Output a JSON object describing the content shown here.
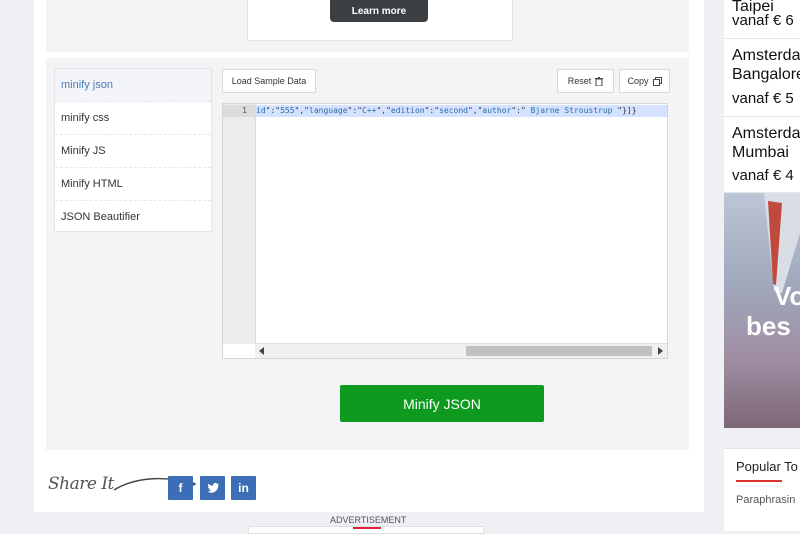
{
  "ad_top": {
    "learn_more": "Learn more"
  },
  "tools": [
    {
      "label": "minify json",
      "active": true
    },
    {
      "label": "minify css",
      "active": false
    },
    {
      "label": "Minify JS",
      "active": false
    },
    {
      "label": "Minify HTML",
      "active": false
    },
    {
      "label": "JSON Beautifier",
      "active": false
    }
  ],
  "toolbar": {
    "load_sample": "Load Sample Data",
    "reset": "Reset",
    "copy": "Copy"
  },
  "editor": {
    "line_number": "1",
    "code_segments": [
      {
        "t": "id",
        "k": "s"
      },
      {
        "t": "\":\"",
        "k": "p"
      },
      {
        "t": "555",
        "k": "s"
      },
      {
        "t": "\",\"",
        "k": "p"
      },
      {
        "t": "language",
        "k": "s"
      },
      {
        "t": "\":\"",
        "k": "p"
      },
      {
        "t": "C++",
        "k": "s"
      },
      {
        "t": "\",\"",
        "k": "p"
      },
      {
        "t": "edition",
        "k": "s"
      },
      {
        "t": "\":\"",
        "k": "p"
      },
      {
        "t": "second",
        "k": "s"
      },
      {
        "t": "\",\"",
        "k": "p"
      },
      {
        "t": "author",
        "k": "s"
      },
      {
        "t": "\":\"",
        "k": "p"
      },
      {
        "t": " Bjarne Stroustrup ",
        "k": "s"
      },
      {
        "t": "\"}]}",
        "k": "p"
      }
    ]
  },
  "action": {
    "minify_label": "Minify JSON"
  },
  "share": {
    "label": "Share It",
    "facebook": "f",
    "twitter": "t",
    "linkedin": "in"
  },
  "ad_bottom": {
    "label": "ADVERTISEMENT"
  },
  "sidebar_ads": {
    "flights": [
      {
        "city": "Taipei",
        "price": "vanaf € 6"
      },
      {
        "city": "Amsterdam",
        "city2": "Bangalore",
        "price": "vanaf € 5"
      },
      {
        "city": "Amsterdam",
        "city2": "Mumbai",
        "price": "vanaf € 4"
      }
    ],
    "promo_line1": "Vo",
    "promo_line2": "bes"
  },
  "popular": {
    "title": "Popular To",
    "first_item": "Paraphrasin"
  },
  "colors": {
    "accent_green": "#0e9a1f",
    "social_blue": "#3b6eb4",
    "active_link": "#4a79b8"
  }
}
